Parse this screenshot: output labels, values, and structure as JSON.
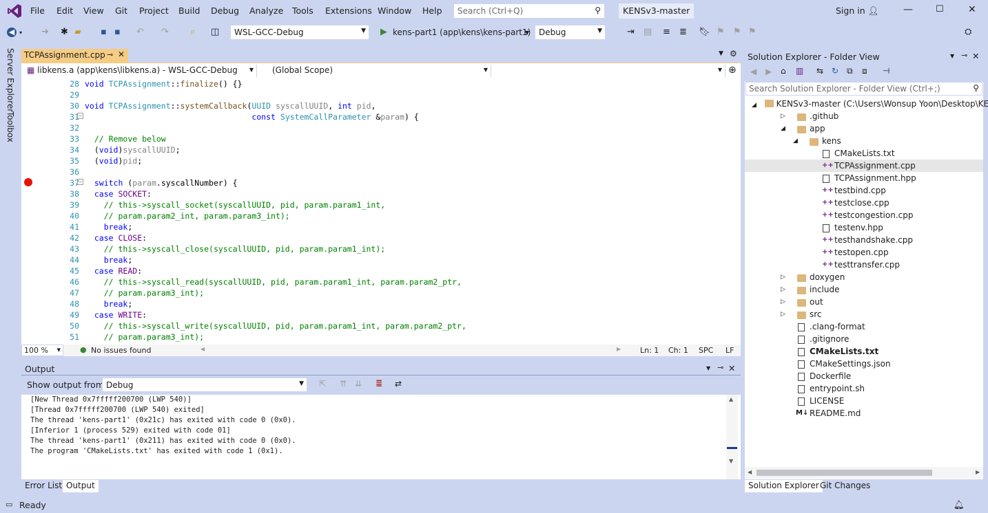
{
  "menu": {
    "items": [
      "File",
      "Edit",
      "View",
      "Git",
      "Project",
      "Build",
      "Debug",
      "Analyze",
      "Tools",
      "Extensions",
      "Window",
      "Help"
    ],
    "search_placeholder": "Search (Ctrl+Q)",
    "solution_title": "KENSv3-master",
    "sign_in": "Sign in"
  },
  "toolbar": {
    "config": "WSL-GCC-Debug",
    "run_target": "kens-part1 (app\\kens\\kens-part1)",
    "run_mode": "Debug"
  },
  "side_tabs": [
    "Server Explorer",
    "Toolbox"
  ],
  "editor": {
    "tab_label": "TCPAssignment.cpp",
    "nav_project": "libkens.a (app\\kens\\libkens.a) - WSL-GCC-Debug",
    "nav_scope": "(Global Scope)",
    "nav_member": "",
    "breakpoint_line": 37,
    "lines": [
      {
        "n": "28",
        "t": "void TCPAssignment::finalize() {}"
      },
      {
        "n": "29",
        "t": ""
      },
      {
        "n": "30",
        "t": "void TCPAssignment::systemCallback(UUID syscallUUID, int pid,"
      },
      {
        "n": "31",
        "t": "                                   const SystemCallParameter &param) {"
      },
      {
        "n": "32",
        "t": ""
      },
      {
        "n": "33",
        "t": "  // Remove below"
      },
      {
        "n": "34",
        "t": "  (void)syscallUUID;"
      },
      {
        "n": "35",
        "t": "  (void)pid;"
      },
      {
        "n": "36",
        "t": ""
      },
      {
        "n": "37",
        "t": "  switch (param.syscallNumber) {"
      },
      {
        "n": "38",
        "t": "  case SOCKET:"
      },
      {
        "n": "39",
        "t": "    // this->syscall_socket(syscallUUID, pid, param.param1_int,"
      },
      {
        "n": "40",
        "t": "    // param.param2_int, param.param3_int);"
      },
      {
        "n": "41",
        "t": "    break;"
      },
      {
        "n": "42",
        "t": "  case CLOSE:"
      },
      {
        "n": "43",
        "t": "    // this->syscall_close(syscallUUID, pid, param.param1_int);"
      },
      {
        "n": "44",
        "t": "    break;"
      },
      {
        "n": "45",
        "t": "  case READ:"
      },
      {
        "n": "46",
        "t": "    // this->syscall_read(syscallUUID, pid, param.param1_int, param.param2_ptr,"
      },
      {
        "n": "47",
        "t": "    // param.param3_int);"
      },
      {
        "n": "48",
        "t": "    break;"
      },
      {
        "n": "49",
        "t": "  case WRITE:"
      },
      {
        "n": "50",
        "t": "    // this->syscall_write(syscallUUID, pid, param.param1_int, param.param2_ptr,"
      },
      {
        "n": "51",
        "t": "    // param.param3_int);"
      }
    ],
    "zoom": "100 %",
    "issues": "No issues found",
    "ln": "Ln: 1",
    "ch": "Ch: 1",
    "spc": "SPC",
    "eol": "LF"
  },
  "output": {
    "title": "Output",
    "show_from_label": "Show output from:",
    "source": "Debug",
    "lines": [
      "[New Thread 0x7fffff200700 (LWP 540)]",
      "[Thread 0x7fffff200700 (LWP 540) exited]",
      "The thread 'kens-part1' (0x21c) has exited with code 0 (0x0).",
      "[Inferior 1 (process 529) exited with code 01]",
      "The thread 'kens-part1' (0x211) has exited with code 0 (0x0).",
      "The program 'CMakeLists.txt' has exited with code 1 (0x1)."
    ]
  },
  "bottom_tabs": [
    "Error List",
    "Output"
  ],
  "solution_explorer": {
    "title": "Solution Explorer - Folder View",
    "search_placeholder": "Search Solution Explorer - Folder View (Ctrl+;)",
    "root": "KENSv3-master (C:\\Users\\Wonsup Yoon\\Desktop\\KE",
    "items": [
      {
        "label": ".github",
        "kind": "folder",
        "depth": 1,
        "exp": "▷"
      },
      {
        "label": "app",
        "kind": "folder",
        "depth": 1,
        "exp": "◢"
      },
      {
        "label": "kens",
        "kind": "folder",
        "depth": 2,
        "exp": "◢"
      },
      {
        "label": "CMakeLists.txt",
        "kind": "doc",
        "depth": 3,
        "exp": ""
      },
      {
        "label": "TCPAssignment.cpp",
        "kind": "cpp",
        "depth": 3,
        "exp": ""
      },
      {
        "label": "TCPAssignment.hpp",
        "kind": "doc",
        "depth": 3,
        "exp": ""
      },
      {
        "label": "testbind.cpp",
        "kind": "cpp",
        "depth": 3,
        "exp": ""
      },
      {
        "label": "testclose.cpp",
        "kind": "cpp",
        "depth": 3,
        "exp": ""
      },
      {
        "label": "testcongestion.cpp",
        "kind": "cpp",
        "depth": 3,
        "exp": ""
      },
      {
        "label": "testenv.hpp",
        "kind": "doc",
        "depth": 3,
        "exp": ""
      },
      {
        "label": "testhandshake.cpp",
        "kind": "cpp",
        "depth": 3,
        "exp": ""
      },
      {
        "label": "testopen.cpp",
        "kind": "cpp",
        "depth": 3,
        "exp": ""
      },
      {
        "label": "testtransfer.cpp",
        "kind": "cpp",
        "depth": 3,
        "exp": ""
      },
      {
        "label": "doxygen",
        "kind": "folder",
        "depth": 1,
        "exp": "▷"
      },
      {
        "label": "include",
        "kind": "folder",
        "depth": 1,
        "exp": "▷"
      },
      {
        "label": "out",
        "kind": "folder",
        "depth": 1,
        "exp": "▷"
      },
      {
        "label": "src",
        "kind": "folder",
        "depth": 1,
        "exp": "▷"
      },
      {
        "label": ".clang-format",
        "kind": "doc",
        "depth": 1,
        "exp": ""
      },
      {
        "label": ".gitignore",
        "kind": "doc",
        "depth": 1,
        "exp": ""
      },
      {
        "label": "CMakeLists.txt",
        "kind": "doc",
        "depth": 1,
        "exp": "",
        "bold": true
      },
      {
        "label": "CMakeSettings.json",
        "kind": "doc",
        "depth": 1,
        "exp": ""
      },
      {
        "label": "Dockerfile",
        "kind": "doc",
        "depth": 1,
        "exp": ""
      },
      {
        "label": "entrypoint.sh",
        "kind": "doc",
        "depth": 1,
        "exp": ""
      },
      {
        "label": "LICENSE",
        "kind": "doc",
        "depth": 1,
        "exp": ""
      },
      {
        "label": "README.md",
        "kind": "md",
        "depth": 1,
        "exp": ""
      }
    ],
    "tabs": [
      "Solution Explorer",
      "Git Changes"
    ]
  },
  "status": {
    "text": "Ready"
  },
  "colors": {
    "chrome": "#ccd5f0",
    "active_tab": "#f5cc84",
    "breakpoint": "#e51400",
    "keyword": "#0000ff",
    "type": "#2b91af",
    "comment": "#008000"
  }
}
